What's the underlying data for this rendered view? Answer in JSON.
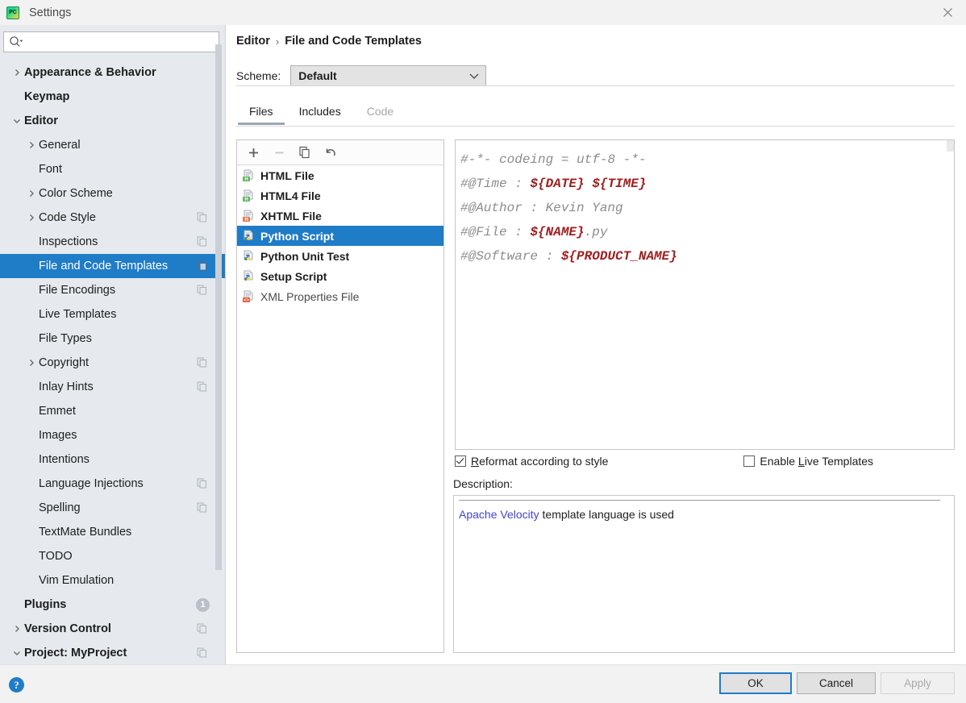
{
  "window": {
    "title": "Settings",
    "app_icon": "pycharm-icon",
    "close_icon": "close-icon"
  },
  "sidebar": {
    "search": {
      "placeholder": "",
      "value": "",
      "icon": "search-icon"
    },
    "items": [
      {
        "label": "Appearance & Behavior",
        "indent": 0,
        "arrow": "right",
        "bold": true,
        "badge": null,
        "selected": false
      },
      {
        "label": "Keymap",
        "indent": 0,
        "arrow": null,
        "bold": true,
        "badge": null,
        "selected": false
      },
      {
        "label": "Editor",
        "indent": 0,
        "arrow": "down",
        "bold": true,
        "badge": null,
        "selected": false
      },
      {
        "label": "General",
        "indent": 1,
        "arrow": "right",
        "bold": false,
        "badge": null,
        "selected": false
      },
      {
        "label": "Font",
        "indent": 1,
        "arrow": null,
        "bold": false,
        "badge": null,
        "selected": false
      },
      {
        "label": "Color Scheme",
        "indent": 1,
        "arrow": "right",
        "bold": false,
        "badge": null,
        "selected": false
      },
      {
        "label": "Code Style",
        "indent": 1,
        "arrow": "right",
        "bold": false,
        "badge": "copy",
        "selected": false
      },
      {
        "label": "Inspections",
        "indent": 1,
        "arrow": null,
        "bold": false,
        "badge": "copy",
        "selected": false
      },
      {
        "label": "File and Code Templates",
        "indent": 1,
        "arrow": null,
        "bold": false,
        "badge": "copy",
        "selected": true
      },
      {
        "label": "File Encodings",
        "indent": 1,
        "arrow": null,
        "bold": false,
        "badge": "copy",
        "selected": false
      },
      {
        "label": "Live Templates",
        "indent": 1,
        "arrow": null,
        "bold": false,
        "badge": null,
        "selected": false
      },
      {
        "label": "File Types",
        "indent": 1,
        "arrow": null,
        "bold": false,
        "badge": null,
        "selected": false
      },
      {
        "label": "Copyright",
        "indent": 1,
        "arrow": "right",
        "bold": false,
        "badge": "copy",
        "selected": false
      },
      {
        "label": "Inlay Hints",
        "indent": 1,
        "arrow": null,
        "bold": false,
        "badge": "copy",
        "selected": false
      },
      {
        "label": "Emmet",
        "indent": 1,
        "arrow": null,
        "bold": false,
        "badge": null,
        "selected": false
      },
      {
        "label": "Images",
        "indent": 1,
        "arrow": null,
        "bold": false,
        "badge": null,
        "selected": false
      },
      {
        "label": "Intentions",
        "indent": 1,
        "arrow": null,
        "bold": false,
        "badge": null,
        "selected": false
      },
      {
        "label": "Language Injections",
        "indent": 1,
        "arrow": null,
        "bold": false,
        "badge": "copy",
        "selected": false
      },
      {
        "label": "Spelling",
        "indent": 1,
        "arrow": null,
        "bold": false,
        "badge": "copy",
        "selected": false
      },
      {
        "label": "TextMate Bundles",
        "indent": 1,
        "arrow": null,
        "bold": false,
        "badge": null,
        "selected": false
      },
      {
        "label": "TODO",
        "indent": 1,
        "arrow": null,
        "bold": false,
        "badge": null,
        "selected": false
      },
      {
        "label": "Vim Emulation",
        "indent": 1,
        "arrow": null,
        "bold": false,
        "badge": null,
        "selected": false
      },
      {
        "label": "Plugins",
        "indent": 0,
        "arrow": null,
        "bold": true,
        "badge": "count",
        "badge_text": "1",
        "selected": false
      },
      {
        "label": "Version Control",
        "indent": 0,
        "arrow": "right",
        "bold": true,
        "badge": "copy",
        "selected": false
      },
      {
        "label": "Project: MyProject",
        "indent": 0,
        "arrow": "down",
        "bold": true,
        "badge": "copy",
        "selected": false
      }
    ]
  },
  "main": {
    "breadcrumb": {
      "parent": "Editor",
      "separator": "›",
      "current": "File and Code Templates"
    },
    "scheme": {
      "label": "Scheme:",
      "value": "Default",
      "caret_icon": "chevron-down-icon"
    },
    "tabs": [
      {
        "label": "Files",
        "state": "active"
      },
      {
        "label": "Includes",
        "state": "normal"
      },
      {
        "label": "Code",
        "state": "disabled"
      }
    ],
    "list_toolbar": [
      {
        "name": "add-template-button",
        "icon": "plus-icon",
        "state": "enabled"
      },
      {
        "name": "remove-template-button",
        "icon": "minus-icon",
        "state": "disabled"
      },
      {
        "name": "copy-template-button",
        "icon": "copy-icon",
        "state": "enabled"
      },
      {
        "name": "reset-template-button",
        "icon": "revert-icon",
        "state": "enabled"
      }
    ],
    "templates": [
      {
        "label": "HTML File",
        "icon": "html-file-icon",
        "selected": false,
        "muted": false
      },
      {
        "label": "HTML4 File",
        "icon": "html-file-icon",
        "selected": false,
        "muted": false
      },
      {
        "label": "XHTML File",
        "icon": "xhtml-file-icon",
        "selected": false,
        "muted": false
      },
      {
        "label": "Python Script",
        "icon": "python-file-icon",
        "selected": true,
        "muted": false
      },
      {
        "label": "Python Unit Test",
        "icon": "python-file-icon",
        "selected": false,
        "muted": false
      },
      {
        "label": "Setup Script",
        "icon": "python-file-icon",
        "selected": false,
        "muted": false
      },
      {
        "label": "XML Properties File",
        "icon": "xml-file-icon",
        "selected": false,
        "muted": true
      }
    ],
    "editor": {
      "lines": [
        [
          {
            "t": "#-*- codeing = utf-8 -*-",
            "k": "comment"
          }
        ],
        [
          {
            "t": "#@Time : ",
            "k": "comment"
          },
          {
            "t": "${DATE} ${TIME}",
            "k": "var"
          }
        ],
        [
          {
            "t": "#@Author : Kevin Yang",
            "k": "comment"
          }
        ],
        [
          {
            "t": "#@File : ",
            "k": "comment"
          },
          {
            "t": "${NAME}",
            "k": "var"
          },
          {
            "t": ".py",
            "k": "comment"
          }
        ],
        [
          {
            "t": "#@Software : ",
            "k": "comment"
          },
          {
            "t": "${PRODUCT_NAME}",
            "k": "var"
          }
        ]
      ]
    },
    "checkboxes": [
      {
        "label_pre": "",
        "mnemonic": "R",
        "label_post": "eformat according to style",
        "checked": true
      },
      {
        "label_pre": "Enable ",
        "mnemonic": "L",
        "label_post": "ive Templates",
        "checked": false
      }
    ],
    "description": {
      "label": "Description:",
      "link_text": "Apache Velocity",
      "rest_text": " template language is used"
    }
  },
  "footer": {
    "help_icon": "help-icon",
    "help_glyph": "?",
    "buttons": [
      {
        "label": "OK",
        "state": "default"
      },
      {
        "label": "Cancel",
        "state": "enabled"
      },
      {
        "label": "Apply",
        "state": "disabled"
      }
    ]
  },
  "colors": {
    "selection_blue": "#1f7cc7",
    "sidebar_bg": "#e6eaee",
    "titlebar_bg": "#f2f2f2",
    "code_comment": "#8c8c8c",
    "code_variable": "#9e1f1f",
    "link": "#4444cc"
  }
}
